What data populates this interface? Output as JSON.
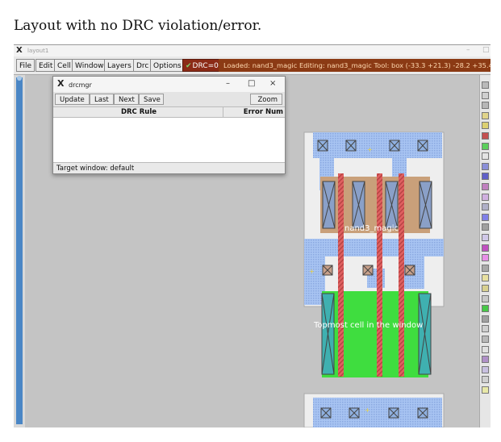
{
  "caption": "Layout with no DRC violation/error.",
  "window": {
    "title": "layout1",
    "minimize": "–",
    "maximize": "□"
  },
  "menu": {
    "items": [
      "File",
      "Edit",
      "Cell",
      "Window",
      "Layers",
      "Drc",
      "Options"
    ],
    "drc_indicator": "DRC=0",
    "status": "Loaded: nand3_magic Editing: nand3_magic Tool: box   (-33.3 +21.3) -28.2 +35.4 m"
  },
  "drc_manager": {
    "title": "drcmgr",
    "minimize": "–",
    "maximize": "□",
    "close": "×",
    "buttons": [
      "Update",
      "Last",
      "Next",
      "Save"
    ],
    "zoom_label": "Zoom",
    "col_rule": "DRC Rule",
    "col_errors": "Error Num",
    "footer": "Target window:  default"
  },
  "layout": {
    "cell_label": "nand3_magic",
    "top_label": "Topmost cell in the window"
  },
  "colors": {
    "metal1": "#9cb8ee",
    "poly": "#e06060",
    "pdiff": "#c9a07a",
    "ndiff": "#3fdd3f",
    "contact": "#8aa8d8",
    "statusbar": "#8b3a14",
    "drc_ok": "#8b2a16"
  },
  "palette": [
    "#b9b9b9",
    "#cfcfcf",
    "#b7b7b7",
    "#e0d48a",
    "#dcd070",
    "#c45050",
    "#5ccf5c",
    "#e4e4e4",
    "#8a8fd8",
    "#6060c8",
    "#c080c0",
    "#d0b0e0",
    "#b0b0c8",
    "#8080e8",
    "#a0a0a0",
    "#d0c8e8",
    "#c050c0",
    "#e890e8",
    "#a8a8a8",
    "#e8e0a0",
    "#d8d090",
    "#c8c8c8",
    "#48c848",
    "#a0a0a0",
    "#cfcfcf",
    "#b8b8b8",
    "#e0e0e0",
    "#b090c8",
    "#c8c0e0",
    "#d0d0d0",
    "#e8e8a8"
  ]
}
